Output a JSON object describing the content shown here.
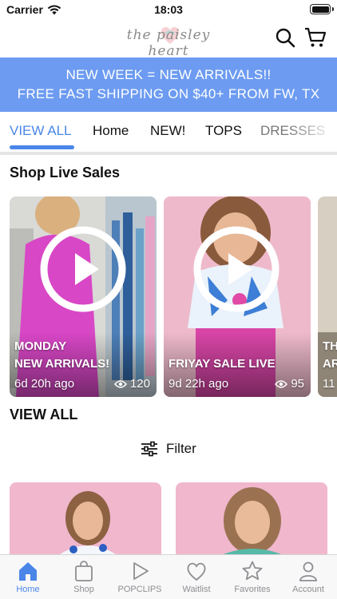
{
  "status": {
    "carrier": "Carrier",
    "time": "18:03"
  },
  "header": {
    "logo_text": "the paisley heart"
  },
  "banner": {
    "line1": "NEW WEEK = NEW ARRIVALS!!",
    "line2": "FREE FAST SHIPPING ON $40+ FROM FW, TX"
  },
  "tabs": [
    "VIEW ALL",
    "Home",
    "NEW!",
    "TOPS",
    "DRESSES"
  ],
  "live": {
    "title": "Shop Live Sales",
    "cards": [
      {
        "label1": "MONDAY",
        "label2": "NEW ARRIVALS!",
        "time": "6d 20h ago",
        "views": "120"
      },
      {
        "label1": "",
        "label2": "FRIYAY SALE LIVE",
        "time": "9d 22h ago",
        "views": "95"
      },
      {
        "label1": "TH",
        "label2": "AR",
        "time": "11"
      }
    ]
  },
  "view_all": {
    "title": "VIEW ALL",
    "filter_label": "Filter"
  },
  "nav": [
    "Home",
    "Shop",
    "POPCLIPS",
    "Waitlist",
    "Favorites",
    "Account"
  ],
  "colors": {
    "accent": "#4a86e8",
    "banner": "#6c9bf1",
    "inactive": "#8e8e93"
  }
}
